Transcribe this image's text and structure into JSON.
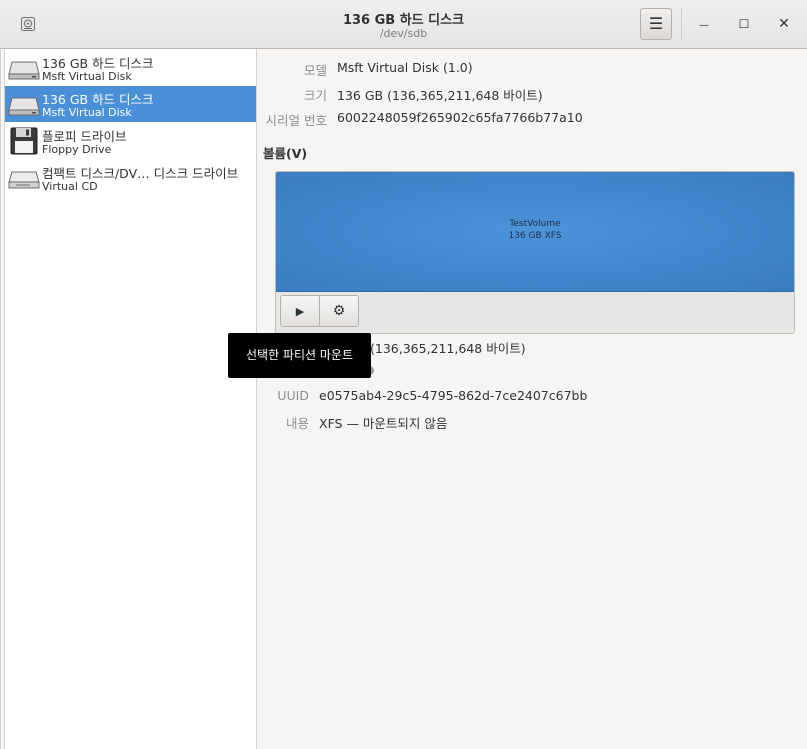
{
  "header": {
    "title": "136 GB 하드 디스크",
    "subtitle": "/dev/sdb",
    "menu_icon": "☰",
    "minimize": "—",
    "maximize": "☐",
    "close": "✕"
  },
  "sidebar": {
    "items": [
      {
        "name": "136 GB 하드 디스크",
        "sub": "Msft Virtual Disk",
        "icon": "hard-disk-icon",
        "selected": false
      },
      {
        "name": "136 GB 하드 디스크",
        "sub": "Msft Virtual Disk",
        "icon": "hard-disk-icon",
        "selected": true
      },
      {
        "name": "플로피 드라이브",
        "sub": "Floppy Drive",
        "icon": "floppy-icon",
        "selected": false
      },
      {
        "name": "컴팩트 디스크/DV… 디스크 드라이브",
        "sub": "Virtual CD",
        "icon": "optical-drive-icon",
        "selected": false
      }
    ]
  },
  "details": {
    "model_label": "모델",
    "model_value": "Msft Virtual Disk (1.0)",
    "size_label": "크기",
    "size_value": "136 GB (136,365,211,648 바이트)",
    "serial_label": "시리얼 번호",
    "serial_value": "6002248059f265902c65fa7766b77a10"
  },
  "volumes": {
    "heading": "볼륨(V)",
    "partition_name": "TestVolume",
    "partition_size": "136 GB XFS",
    "play_icon": "▶",
    "gear_icon": "⚙",
    "size_value_partial": "(136,365,211,648 바이트)",
    "uuid_label": "UUID",
    "uuid_value": "e0575ab4-29c5-4795-862d-7ce2407c67bb",
    "contents_label": "내용",
    "contents_value": "XFS — 마운트되지 않음"
  },
  "tooltip": {
    "text": "선택한 파티션 마운트"
  },
  "colors": {
    "selection": "#4a90d9",
    "partition": "#3f83c9",
    "tooltip_bg": "#000000"
  }
}
